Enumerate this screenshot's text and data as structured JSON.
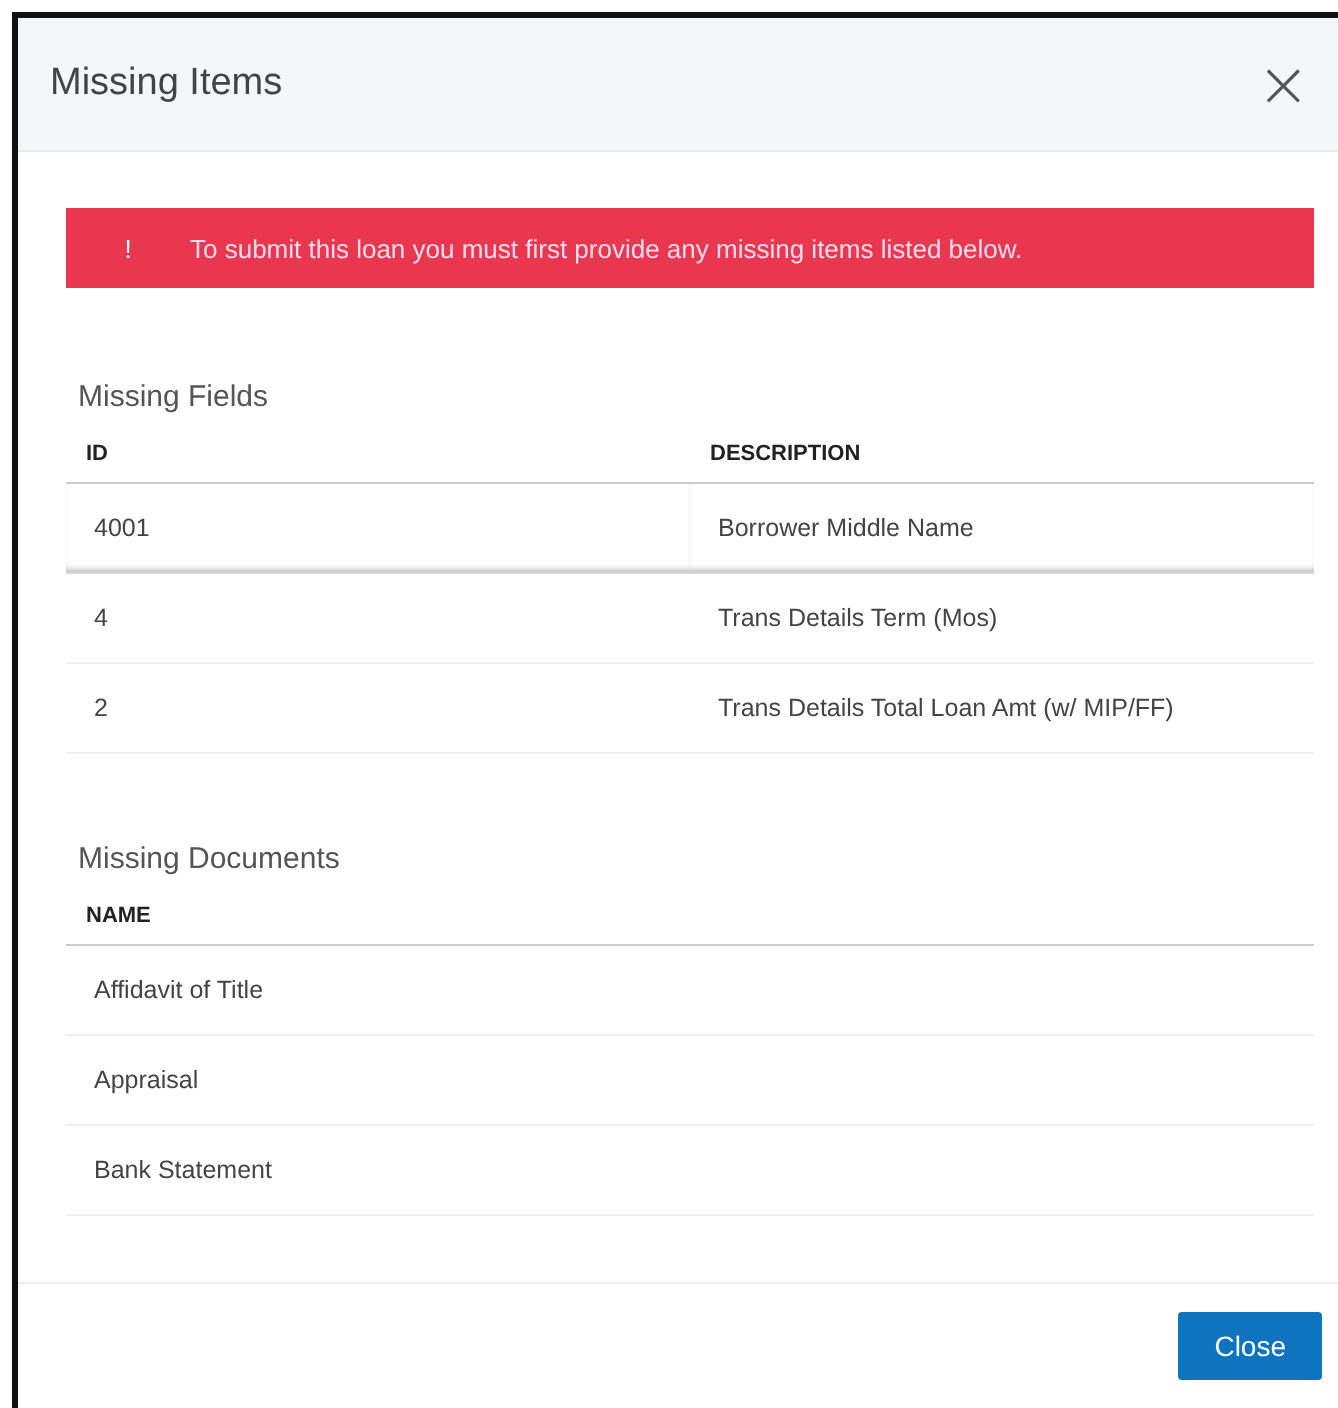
{
  "dialog": {
    "title": "Missing Items",
    "close_icon": "×"
  },
  "alert": {
    "icon": "!",
    "message": "To submit this loan you must first provide any missing items listed below."
  },
  "missing_fields": {
    "title": "Missing Fields",
    "columns": [
      "ID",
      "DESCRIPTION"
    ],
    "rows": [
      {
        "id": "4001",
        "description": "Borrower Middle Name",
        "selected": true
      },
      {
        "id": "4",
        "description": "Trans Details Term (Mos)",
        "selected": false
      },
      {
        "id": "2",
        "description": "Trans Details Total Loan Amt (w/ MIP/FF)",
        "selected": false
      }
    ]
  },
  "missing_documents": {
    "title": "Missing Documents",
    "columns": [
      "NAME"
    ],
    "rows": [
      {
        "name": "Affidavit of Title"
      },
      {
        "name": "Appraisal"
      },
      {
        "name": "Bank Statement"
      }
    ]
  },
  "buttons": [
    "Close"
  ]
}
